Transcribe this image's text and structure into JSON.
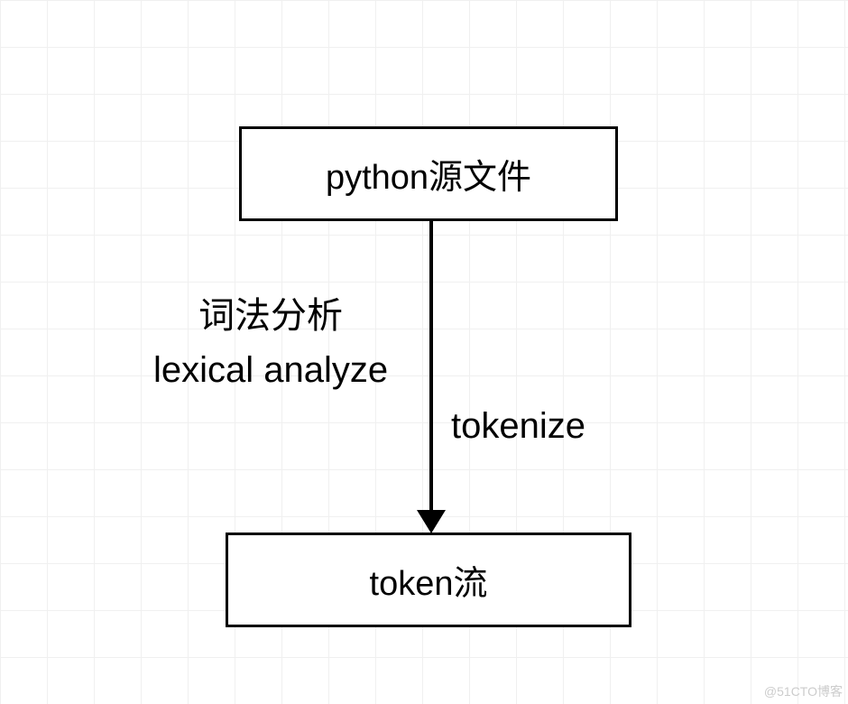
{
  "diagram": {
    "nodes": {
      "top": {
        "label": "python源文件"
      },
      "bottom": {
        "label": "token流"
      }
    },
    "edge": {
      "left_label_line1": "词法分析",
      "left_label_line2": "lexical analyze",
      "right_label": "tokenize"
    }
  },
  "watermark": "@51CTO博客"
}
